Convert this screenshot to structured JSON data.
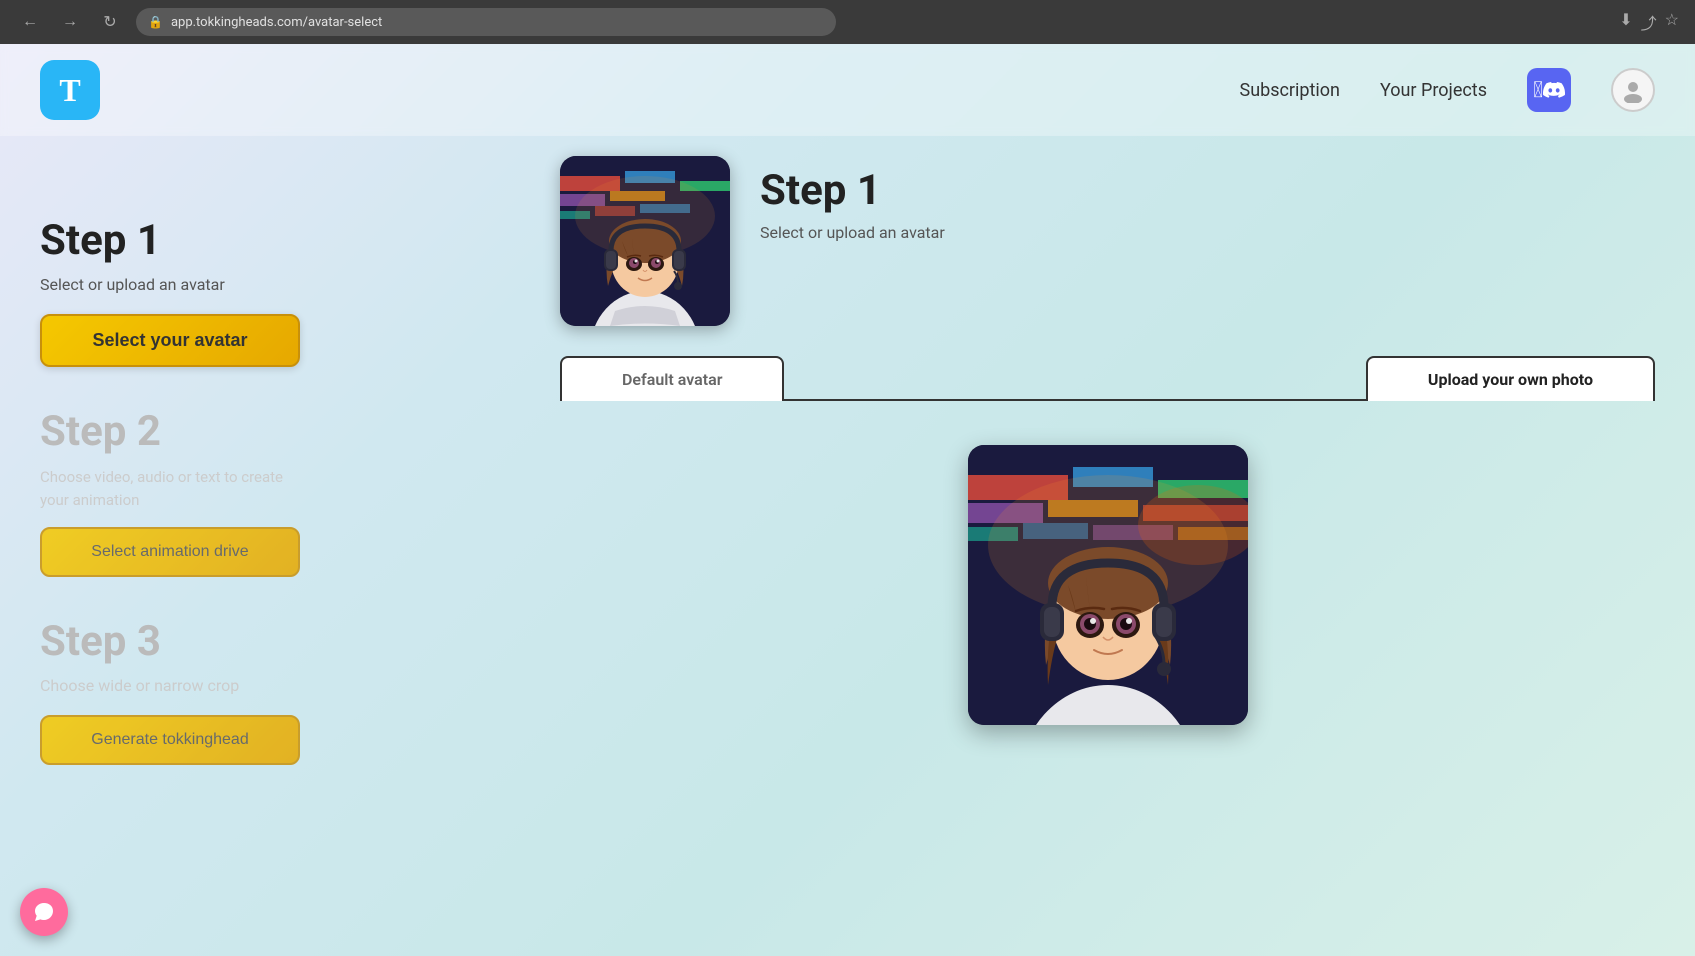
{
  "browser": {
    "url": "app.tokkingheads.com/avatar-select",
    "back_title": "Back",
    "forward_title": "Forward",
    "reload_title": "Reload"
  },
  "header": {
    "logo_text": "T",
    "nav": {
      "subscription_label": "Subscription",
      "your_projects_label": "Your Projects"
    }
  },
  "left_panel": {
    "step1_title": "Step 1",
    "step1_description": "Select or upload an avatar",
    "select_avatar_btn": "Select your avatar",
    "step2_title": "Step 2",
    "step2_description_part1": "Choose video, audio or text to create",
    "step2_description_part2": "your animation",
    "select_animation_btn": "Select animation drive",
    "step3_title": "Step 3",
    "step3_description": "Choose wide or narrow crop",
    "generate_btn": "Generate tokkinghead"
  },
  "right_panel": {
    "step1_title": "Step 1",
    "step1_description": "Select or upload an avatar",
    "tabs": {
      "default_avatar_label": "Default avatar",
      "upload_label": "Upload your own photo"
    }
  },
  "colors": {
    "primary_yellow": "#f5c800",
    "logo_blue": "#29b6f6",
    "discord_purple": "#5865f2",
    "tab_active_border": "#222222"
  }
}
